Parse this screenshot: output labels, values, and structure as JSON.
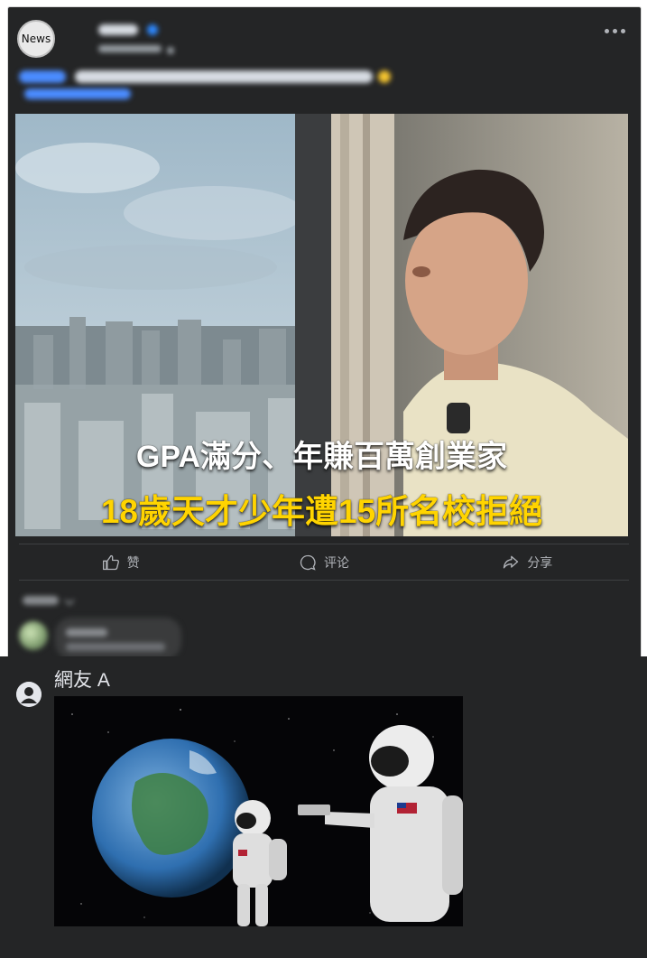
{
  "post": {
    "page_avatar_text": "News",
    "image_caption_line1": "GPA滿分、年賺百萬創業家",
    "image_caption_line2": "18歲天才少年遭15所名校拒絕"
  },
  "actions": {
    "like": "赞",
    "comment": "评论",
    "share": "分享"
  },
  "reply": {
    "author": "網友 A"
  },
  "colors": {
    "card_bg": "#242526",
    "caption_yellow": "#ffd400",
    "link_blue": "#4b8cff"
  }
}
